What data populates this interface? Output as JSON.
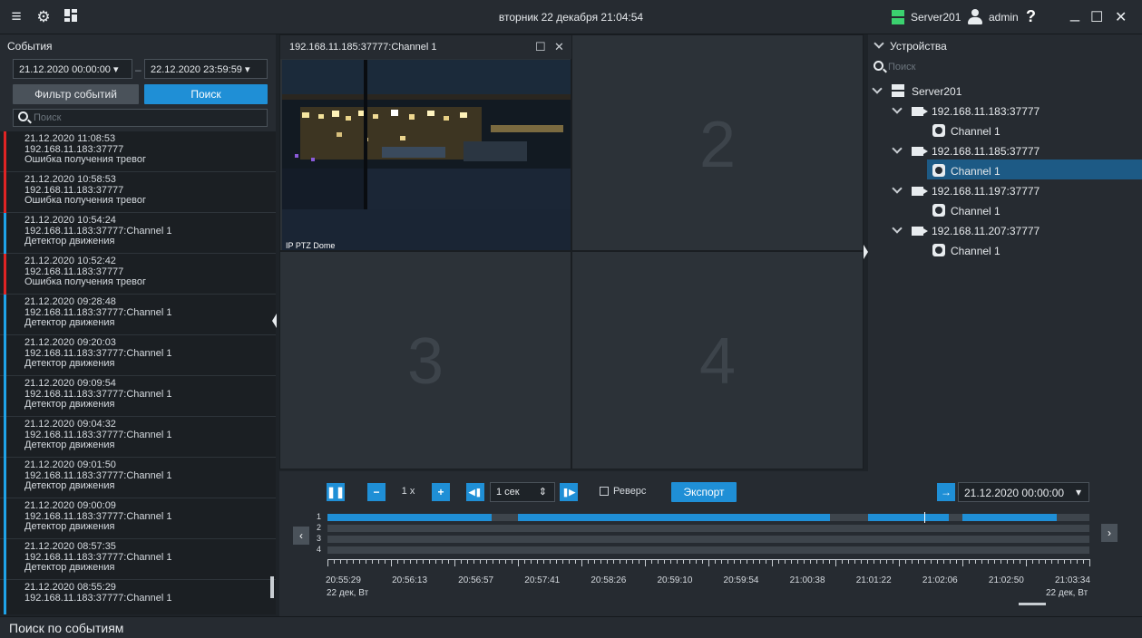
{
  "topbar": {
    "datetime": "вторник 22 декабря 21:04:54",
    "server": "Server201",
    "user": "admin",
    "help": "?",
    "minimize": "_",
    "maximize": "☐",
    "close": "✕"
  },
  "events": {
    "title": "События",
    "date_from": "21.12.2020  00:00:00",
    "date_to": "22.12.2020  23:59:59",
    "filter_label": "Фильтр событий",
    "search_label": "Поиск",
    "search_placeholder": "Поиск",
    "items": [
      {
        "time": "21.12.2020 11:08:53",
        "source": "192.168.11.183:37777",
        "type": "Ошибка получения тревог",
        "color": "#e02424"
      },
      {
        "time": "21.12.2020 10:58:53",
        "source": "192.168.11.183:37777",
        "type": "Ошибка получения тревог",
        "color": "#e02424"
      },
      {
        "time": "21.12.2020 10:54:24",
        "source": "192.168.11.183:37777:Channel 1",
        "type": "Детектор движения",
        "color": "#1fa3e8"
      },
      {
        "time": "21.12.2020 10:52:42",
        "source": "192.168.11.183:37777",
        "type": "Ошибка получения тревог",
        "color": "#e02424"
      },
      {
        "time": "21.12.2020 09:28:48",
        "source": "192.168.11.183:37777:Channel 1",
        "type": "Детектор движения",
        "color": "#1fa3e8"
      },
      {
        "time": "21.12.2020 09:20:03",
        "source": "192.168.11.183:37777:Channel 1",
        "type": "Детектор движения",
        "color": "#1fa3e8"
      },
      {
        "time": "21.12.2020 09:09:54",
        "source": "192.168.11.183:37777:Channel 1",
        "type": "Детектор движения",
        "color": "#1fa3e8"
      },
      {
        "time": "21.12.2020 09:04:32",
        "source": "192.168.11.183:37777:Channel 1",
        "type": "Детектор движения",
        "color": "#1fa3e8"
      },
      {
        "time": "21.12.2020 09:01:50",
        "source": "192.168.11.183:37777:Channel 1",
        "type": "Детектор движения",
        "color": "#1fa3e8"
      },
      {
        "time": "21.12.2020 09:00:09",
        "source": "192.168.11.183:37777:Channel 1",
        "type": "Детектор движения",
        "color": "#1fa3e8"
      },
      {
        "time": "21.12.2020 08:57:35",
        "source": "192.168.11.183:37777:Channel 1",
        "type": "Детектор движения",
        "color": "#1fa3e8"
      },
      {
        "time": "21.12.2020 08:55:29",
        "source": "192.168.11.183:37777:Channel 1",
        "type": "",
        "color": "#1fa3e8"
      }
    ]
  },
  "grid": {
    "cam1_title": "192.168.11.185:37777:Channel  1",
    "cam1_overlay": "IP PTZ Dome",
    "cell2": "2",
    "cell3": "3",
    "cell4": "4"
  },
  "playback": {
    "speed": "1 x",
    "step": "1 сек",
    "reverse_label": "Реверс",
    "export_label": "Экспорт",
    "goto_datetime": "21.12.2020  00:00:00",
    "track_labels": [
      "1",
      "2",
      "3",
      "4"
    ],
    "ticks": [
      "20:55:29",
      "20:56:13",
      "20:56:57",
      "20:57:41",
      "20:58:26",
      "20:59:10",
      "20:59:54",
      "21:00:38",
      "21:01:22",
      "21:02:06",
      "21:02:50",
      "21:03:34"
    ],
    "date_left": "22 дек, Вт",
    "date_right": "22 дек, Вт",
    "track1_segments": [
      [
        0.0,
        0.215
      ],
      [
        0.25,
        0.66
      ],
      [
        0.71,
        0.815
      ],
      [
        0.833,
        0.957
      ]
    ],
    "cursor": 0.783
  },
  "devices": {
    "title": "Устройства",
    "search_placeholder": "Поиск",
    "server": "Server201",
    "cameras": [
      {
        "ip": "192.168.11.183:37777",
        "channel": "Channel 1"
      },
      {
        "ip": "192.168.11.185:37777",
        "channel": "Channel 1"
      },
      {
        "ip": "192.168.11.197:37777",
        "channel": "Channel 1"
      },
      {
        "ip": "192.168.11.207:37777",
        "channel": "Channel 1"
      }
    ]
  },
  "statusbar": {
    "text": "Поиск по событиям"
  },
  "colors": {
    "accent": "#1f8fd6",
    "alarm": "#e02424",
    "motion": "#1fa3e8",
    "server_green": "#3bd16f"
  }
}
